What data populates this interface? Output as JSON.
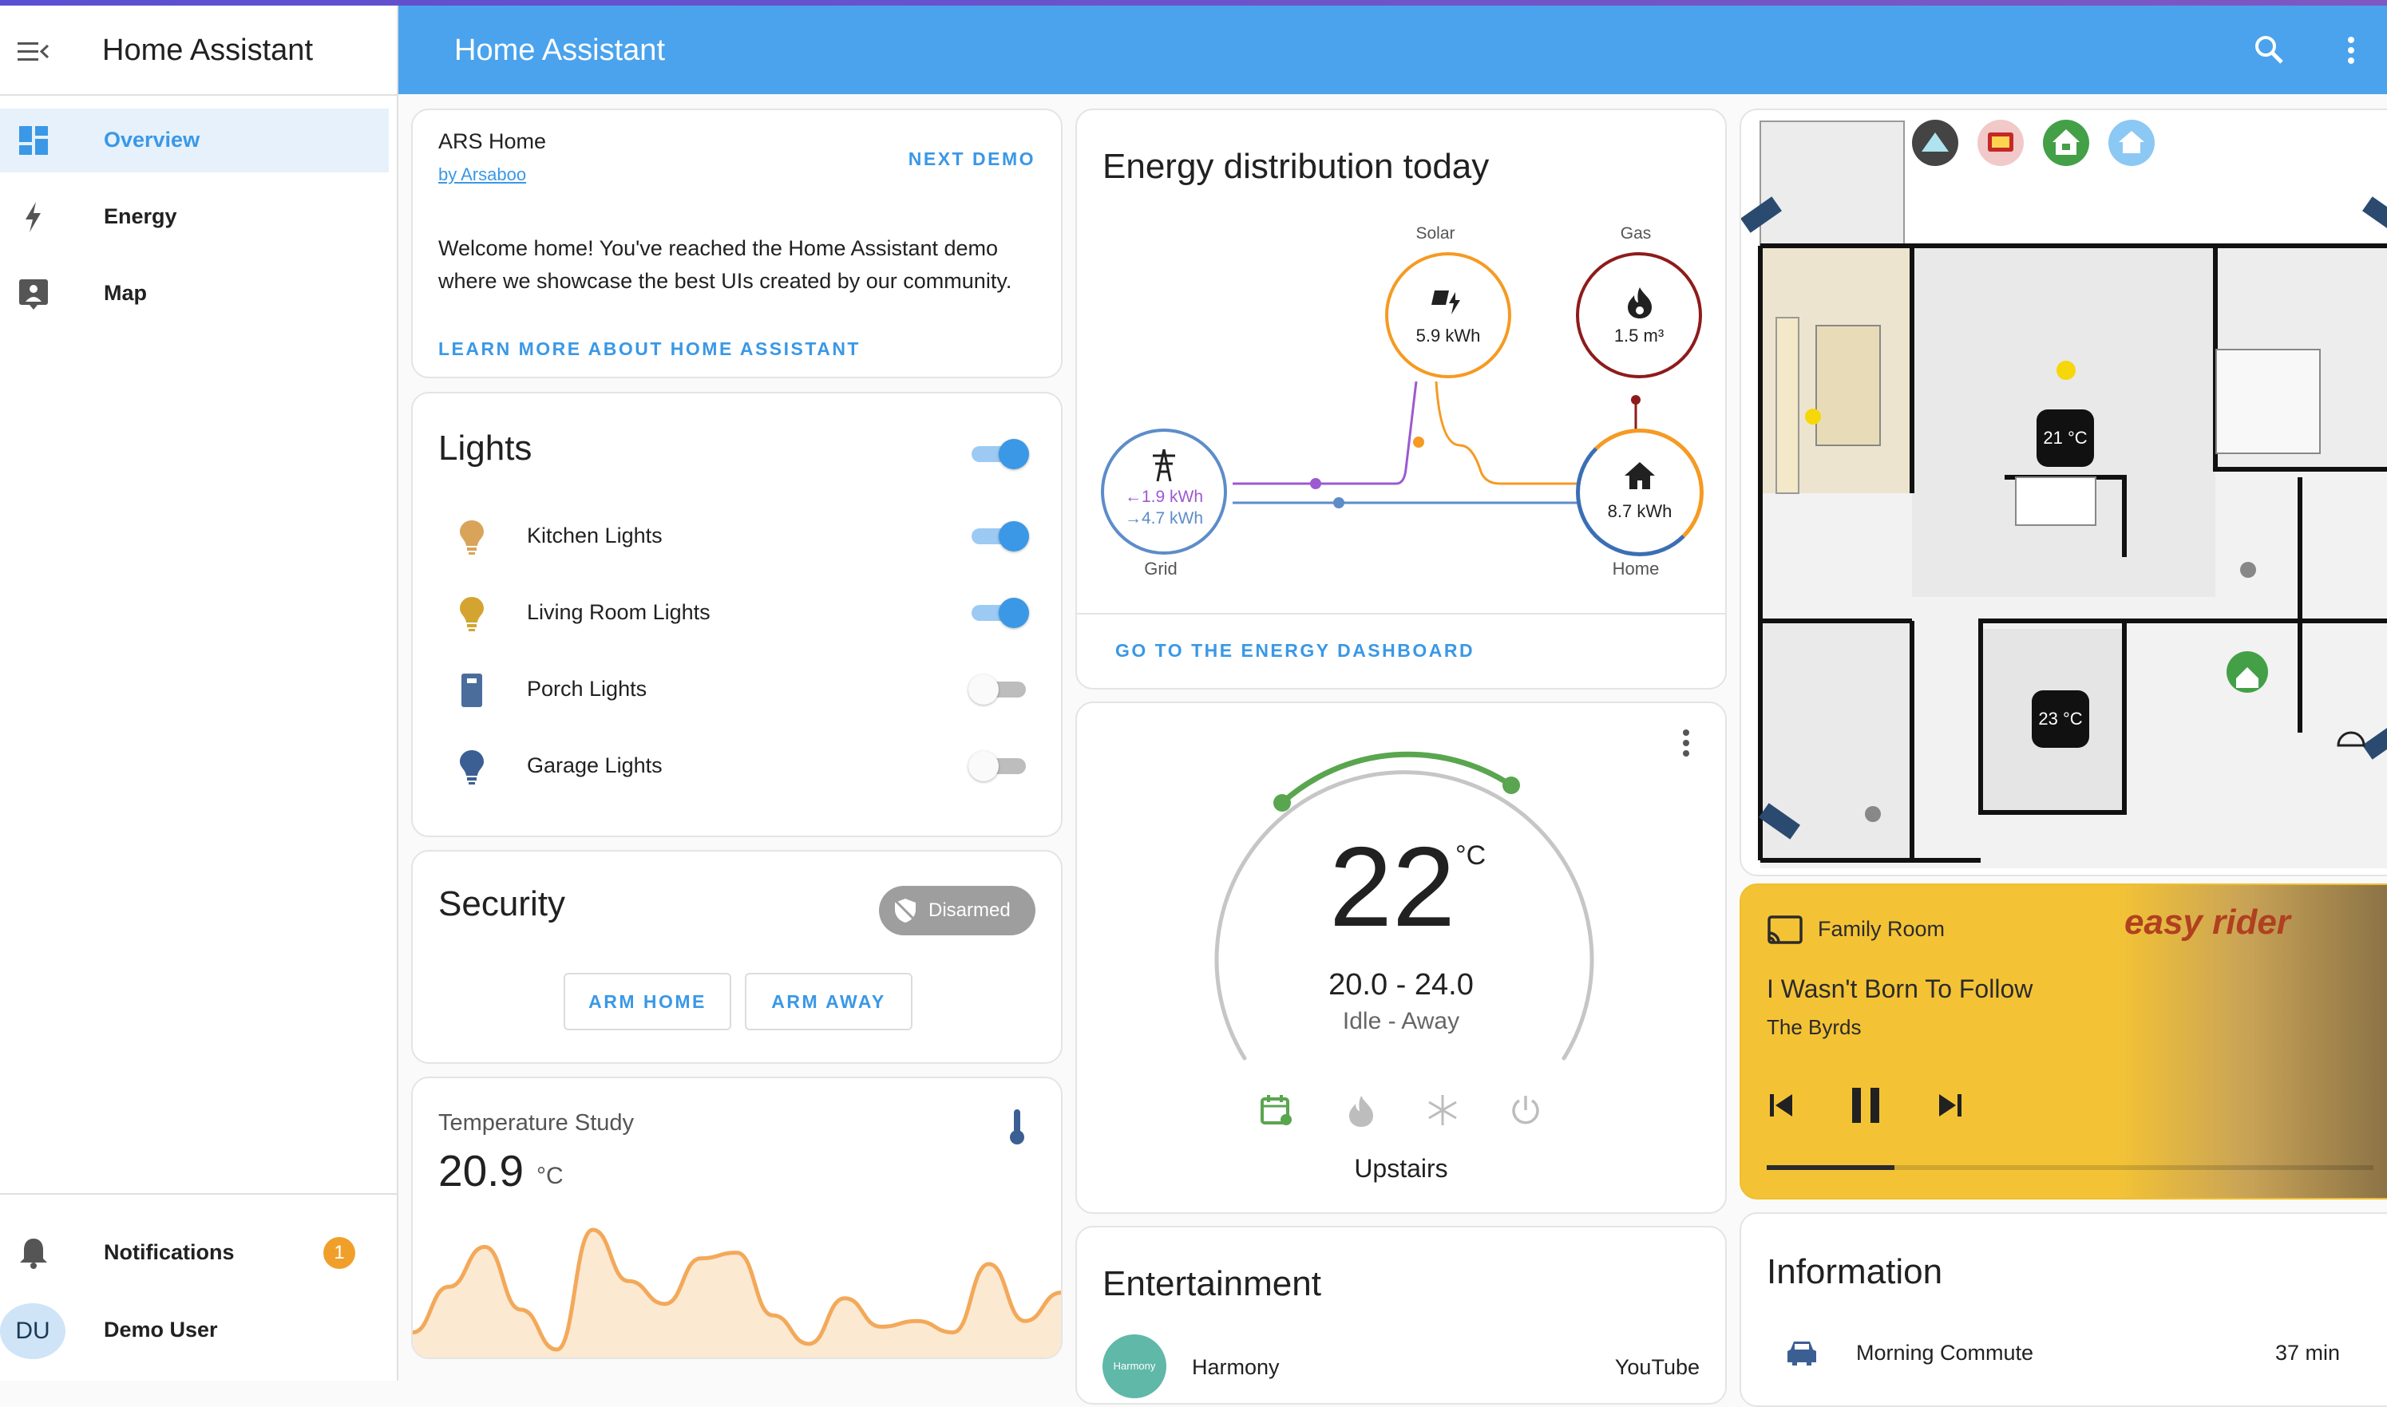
{
  "colors": {
    "primary": "#4aa3ec",
    "accent": "#3a98e6",
    "solar": "#f59a23",
    "gas": "#8e1b1b",
    "grid": "#5d8cc9",
    "home": "#3a6fb5",
    "thermo": "#5aa54f",
    "media_bg": "#f4c335"
  },
  "sidebar": {
    "title": "Home Assistant",
    "items": [
      {
        "label": "Overview",
        "icon": "dashboard-icon"
      },
      {
        "label": "Energy",
        "icon": "lightning-icon"
      },
      {
        "label": "Map",
        "icon": "map-icon"
      }
    ],
    "notifications": {
      "label": "Notifications",
      "count": "1"
    },
    "user": {
      "initials": "DU",
      "name": "Demo User"
    }
  },
  "header": {
    "title": "Home Assistant"
  },
  "demo_card": {
    "title": "ARS Home",
    "byline": "by Arsaboo",
    "next_label": "NEXT DEMO",
    "text": "Welcome home! You've reached the Home Assistant demo where we showcase the best UIs created by our community.",
    "learn_more": "LEARN MORE ABOUT HOME ASSISTANT"
  },
  "lights_card": {
    "title": "Lights",
    "master_on": true,
    "items": [
      {
        "name": "Kitchen Lights",
        "on": true,
        "color": "#d9a45a",
        "icon": "bulb-icon"
      },
      {
        "name": "Living Room Lights",
        "on": true,
        "color": "#d3a530",
        "icon": "bulb-icon"
      },
      {
        "name": "Porch Lights",
        "on": false,
        "color": "#4a6d9c",
        "icon": "lamp-icon"
      },
      {
        "name": "Garage Lights",
        "on": false,
        "color": "#3c5f93",
        "icon": "bulb-icon"
      }
    ]
  },
  "security_card": {
    "title": "Security",
    "state": "Disarmed",
    "arm_home": "ARM HOME",
    "arm_away": "ARM AWAY"
  },
  "temp_card": {
    "title": "Temperature Study",
    "value": "20.9",
    "unit": "°C"
  },
  "chart_data": {
    "type": "line",
    "values": [
      19.8,
      20.6,
      21.3,
      20.2,
      19.5,
      21.6,
      20.7,
      20.3,
      21.1,
      21.2,
      20.1,
      19.6,
      20.4,
      19.9,
      20.0,
      19.8,
      21.0,
      20.0,
      20.5
    ]
  },
  "energy_card": {
    "title": "Energy distribution today",
    "solar": {
      "label": "Solar",
      "value": "5.9 kWh"
    },
    "gas": {
      "label": "Gas",
      "value": "1.5 m³"
    },
    "grid": {
      "label": "Grid",
      "import": "←1.9 kWh",
      "export": "→4.7 kWh"
    },
    "home": {
      "label": "Home",
      "value": "8.7 kWh"
    },
    "link": "GO TO THE ENERGY DASHBOARD"
  },
  "thermostat_card": {
    "temperature": "22",
    "unit": "°C",
    "range": "20.0 - 24.0",
    "state": "Idle - Away",
    "name": "Upstairs",
    "modes": [
      "calendar-sync-icon",
      "flame-icon",
      "snowflake-icon",
      "power-icon"
    ]
  },
  "entertainment_card": {
    "title": "Entertainment",
    "device": "Harmony",
    "badge": "Harmony",
    "activity": "YouTube"
  },
  "floorplan_card": {
    "temp_upper": "21 °C",
    "temp_lower": "23 °C",
    "top_icons": [
      "mountain-icon",
      "tv-icon",
      "home-lock-icon",
      "home-icon"
    ]
  },
  "media_card": {
    "room": "Family Room",
    "track": "I Wasn't Born To Follow",
    "artist": "The Byrds",
    "album_art_text": "easy rider",
    "progress": 0.21
  },
  "info_card": {
    "title": "Information",
    "row_label": "Morning Commute",
    "row_value": "37 min"
  }
}
